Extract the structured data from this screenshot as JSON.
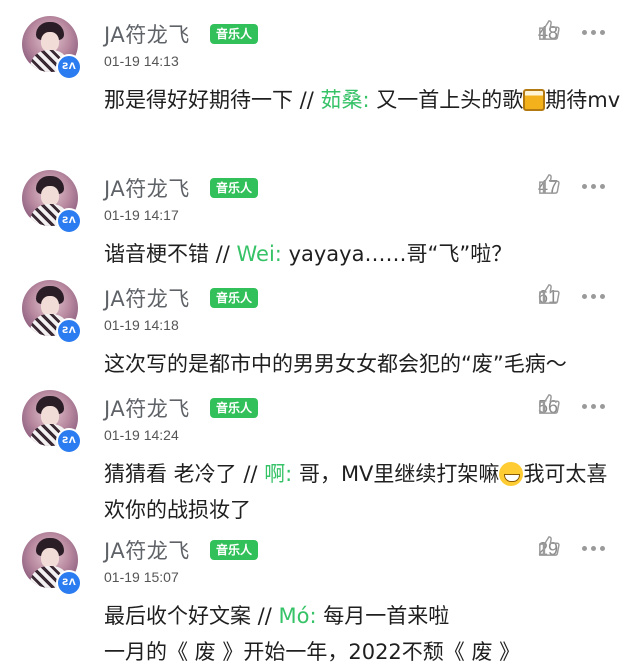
{
  "comments": [
    {
      "user": "JA符龙飞",
      "tag": "音乐人",
      "time": "01-19 14:13",
      "likes": "48",
      "text": "那是得好好期待一下 // ",
      "quote_user": "茹桑:",
      "quote_text_a": " 又一首上头的歌",
      "emoji": "beer-mug",
      "quote_text_b": "期待mv"
    },
    {
      "user": "JA符龙飞",
      "tag": "音乐人",
      "time": "01-19 14:17",
      "likes": "47",
      "text": "谐音梗不错 // ",
      "quote_user": "Wei:",
      "quote_text": " yayaya……哥“飞”啦？"
    },
    {
      "user": "JA符龙飞",
      "tag": "音乐人",
      "time": "01-19 14:18",
      "likes": "61",
      "text": "这次写的是都市中的男男女女都会犯的“废”毛病～"
    },
    {
      "user": "JA符龙飞",
      "tag": "音乐人",
      "time": "01-19 14:24",
      "likes": "56",
      "text": "猜猜看 老冷了 // ",
      "quote_user": "啊:",
      "quote_text_a": " 哥，MV里继续打架嘛",
      "emoji": "grinning-sweat-face",
      "quote_text_b": "我可太喜欢你的战损妆了"
    },
    {
      "user": "JA符龙飞",
      "tag": "音乐人",
      "time": "01-19 15:07",
      "likes": "29",
      "text": "最后收个好文案 // ",
      "quote_user": "Mó:",
      "quote_text_a": " 每月一首来啦",
      "quote_text_b": "一月的《 废 》开始一年，2022不颓《 废 》"
    }
  ],
  "icons": {
    "like": "thumbs-up-icon",
    "more": "more-dots-icon",
    "badge": "badge-icon",
    "badge_text": "ƧΛ"
  },
  "colors": {
    "tag_bg": "#32c05a",
    "quote_name": "#36c267",
    "badge_bg": "#2b7cf0"
  }
}
